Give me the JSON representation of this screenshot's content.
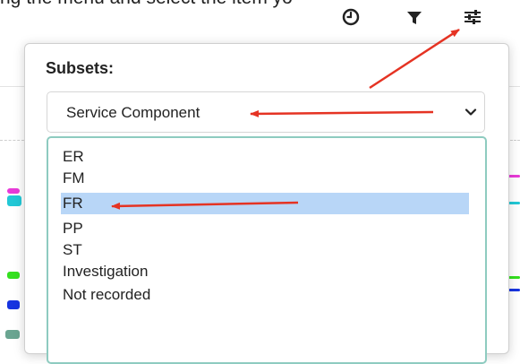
{
  "partial_caption": "ng the menu and select the item yo",
  "toolbar": {
    "icons": [
      "clock-icon",
      "filter-icon",
      "sliders-icon"
    ]
  },
  "panel": {
    "title": "Subsets:",
    "select": {
      "value": "Service Component"
    },
    "options": [
      "ER",
      "FM",
      "FR",
      "PP",
      "ST",
      "Investigation",
      "Not recorded"
    ],
    "selected_option": "FR"
  },
  "colors": {
    "annotation_arrow": "#e53323",
    "selected_row": "#b8d6f7",
    "listbox_border": "#8ecbc0"
  }
}
